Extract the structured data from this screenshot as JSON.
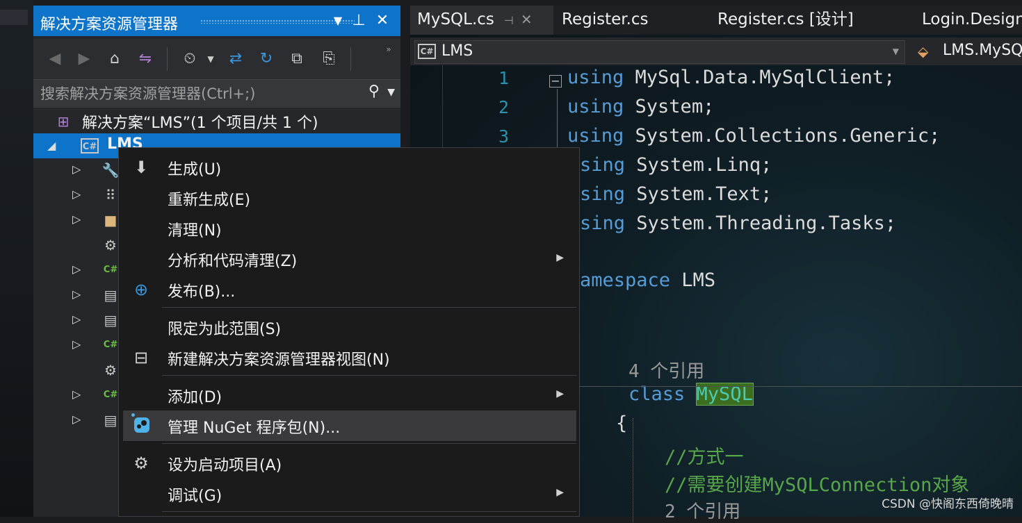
{
  "solution_explorer": {
    "title": "解决方案资源管理器",
    "search_placeholder": "搜索解决方案资源管理器(Ctrl+;)",
    "solution_label": "解决方案“LMS”(1 个项目/共 1 个)",
    "project_label": "LMS"
  },
  "editor": {
    "tabs": [
      {
        "label": "MySQL.cs",
        "active": true
      },
      {
        "label": "Register.cs"
      },
      {
        "label": "Register.cs [设计]"
      },
      {
        "label": "Login.Designer"
      }
    ],
    "nav_project": "LMS",
    "nav_class": "LMS.MySQL",
    "line_numbers": [
      "1",
      "2",
      "3"
    ],
    "code": {
      "l1_kw": "using",
      "l1_rest": " MySql.Data.MySqlClient;",
      "l2_kw": "using",
      "l2_rest": " System;",
      "l3_kw": "using",
      "l3_rest": " System.Collections.Generic;",
      "l4_kw": "sing",
      "l4_rest": " System.Linq;",
      "l5_kw": "sing",
      "l5_rest": " System.Text;",
      "l6_kw": "sing",
      "l6_rest": " System.Threading.Tasks;",
      "l8_kw": "amespace",
      "l8_rest": " LMS",
      "ref_hint_1": "4 个引用",
      "class_kw": "class",
      "class_name": "MySQL",
      "brace": "{",
      "comment_1": "//方式一",
      "comment_2": "//需要创建MySQLConnection对象",
      "ref_hint_2": "2 个引用"
    }
  },
  "context_menu": {
    "items": [
      {
        "label": "生成(U)",
        "icon": "build-icon"
      },
      {
        "label": "重新生成(E)"
      },
      {
        "label": "清理(N)"
      },
      {
        "label": "分析和代码清理(Z)",
        "submenu": true
      },
      {
        "label": "发布(B)...",
        "icon": "globe-icon"
      },
      {
        "label": "限定为此范围(S)"
      },
      {
        "label": "新建解决方案资源管理器视图(N)",
        "icon": "new-view-icon"
      },
      {
        "label": "添加(D)",
        "submenu": true
      },
      {
        "label": "管理 NuGet 程序包(N)...",
        "icon": "nuget-icon",
        "highlighted": true
      },
      {
        "label": "设为启动项目(A)",
        "icon": "gear-icon"
      },
      {
        "label": "调试(G)",
        "submenu": true
      }
    ]
  },
  "watermark": "CSDN @快阁东西倚晚晴",
  "colors": {
    "accent": "#0e74c9",
    "keyword": "#569cd6",
    "comment": "#57a64a",
    "type": "#4ec9b0",
    "line_number": "#2b91af"
  }
}
